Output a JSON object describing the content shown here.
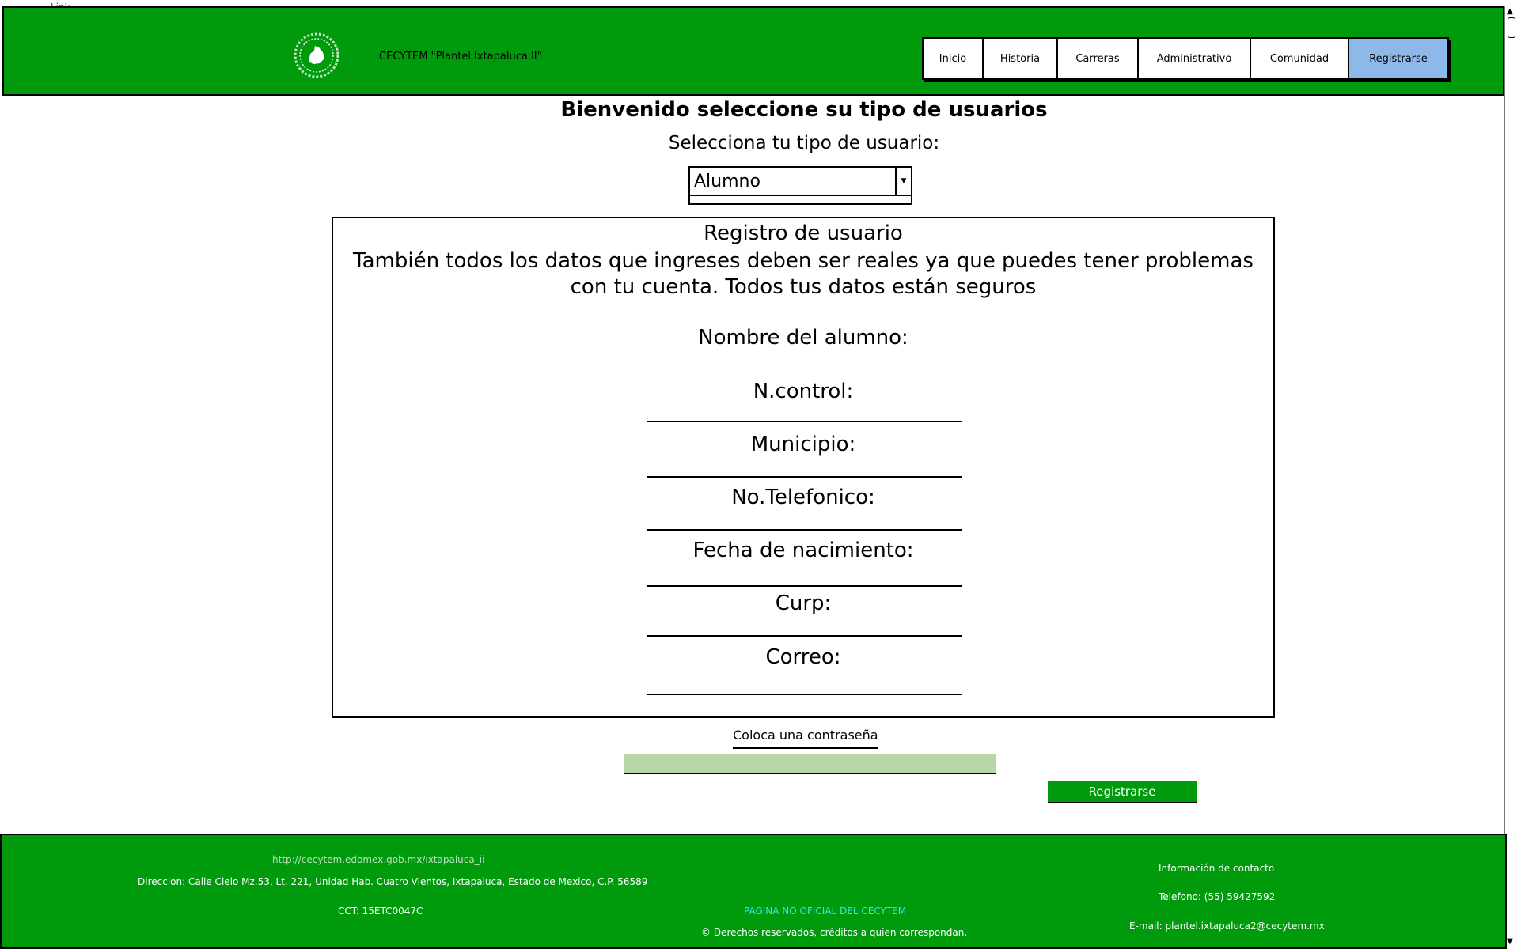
{
  "top_link": "Link",
  "header": {
    "site_title": "CECYTEM \"Plantel Ixtapaluca II\"",
    "nav": [
      {
        "label": "Inicio"
      },
      {
        "label": "Historia"
      },
      {
        "label": "Carreras"
      },
      {
        "label": "Administrativo"
      },
      {
        "label": "Comunidad"
      },
      {
        "label": "Registrarse",
        "active": true
      }
    ]
  },
  "main": {
    "welcome": "Bienvenido seleccione su tipo de usuarios",
    "select_label": "Selecciona tu tipo de usuario:",
    "user_type_selected": "Alumno",
    "form": {
      "title": "Registro de usuario",
      "notice": "También todos los datos que ingreses deben ser reales ya que puedes tener problemas con tu cuenta. Todos tus datos están seguros",
      "fields": [
        {
          "label": "Nombre del alumno:"
        },
        {
          "label": "N.control:"
        },
        {
          "label": "Municipio:"
        },
        {
          "label": "No.Telefonico:"
        },
        {
          "label": "Fecha de nacimiento:"
        },
        {
          "label": "Curp:"
        },
        {
          "label": "Correo:"
        }
      ]
    },
    "password_label": "Coloca una contraseña",
    "password_value": "",
    "register_button": "Registrarse"
  },
  "footer": {
    "url": "http://cecytem.edomex.gob.mx/ixtapaluca_ii",
    "address": "Direccion: Calle Cielo Mz.53, Lt. 221, Unidad Hab. Cuatro Vientos, Ixtapaluca, Estado de Mexico, C.P. 56589",
    "cct": "CCT: 15ETC0047C",
    "not_official": "PAGINA NO OFICIAL DEL CECYTEM",
    "rights": "© Derechos reservados, créditos a quien correspondan.",
    "contact_title": "Información de contacto",
    "phone": "Telefono: (55) 59427592",
    "email": "E-mail: plantel.ixtapaluca2@cecytem.mx"
  },
  "colors": {
    "brand_green": "#009b0c",
    "nav_active": "#8fb8ea",
    "password_fill": "#b7d7a8",
    "footer_link": "#b9e0b9",
    "footer_highlight": "#35e6e6"
  }
}
